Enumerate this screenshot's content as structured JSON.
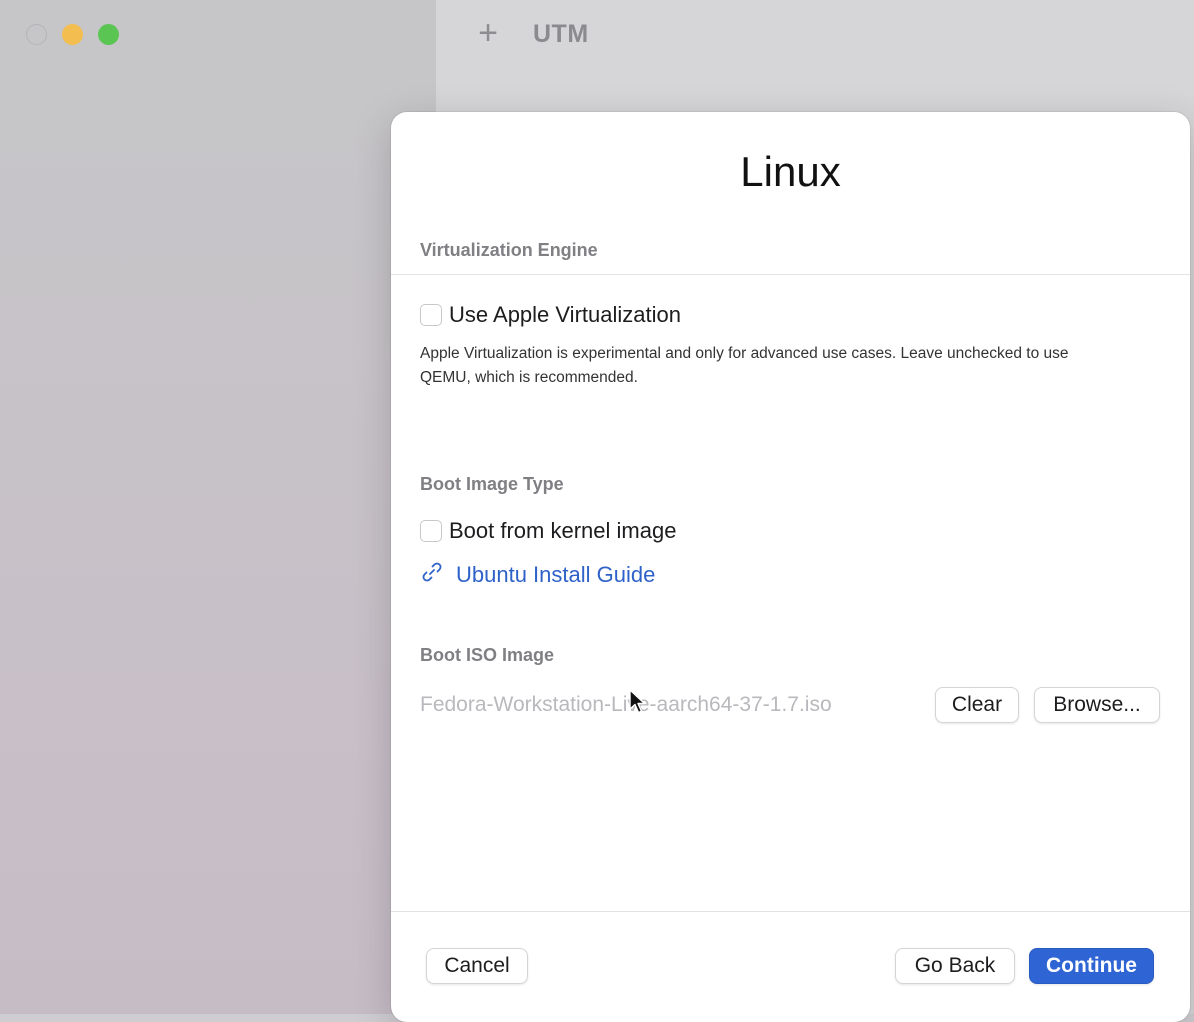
{
  "window": {
    "title": "UTM",
    "add_icon": "plus-icon",
    "traffic_lights": {
      "close": "close-button",
      "minimize": "minimize-button",
      "zoom": "zoom-button"
    }
  },
  "dialog": {
    "title": "Linux",
    "virtualization": {
      "section_label": "Virtualization Engine",
      "checkbox_label": "Use Apple Virtualization",
      "checked": false,
      "note": "Apple Virtualization is experimental and only for advanced use cases. Leave unchecked to use QEMU, which is recommended."
    },
    "boot_image_type": {
      "section_label": "Boot Image Type",
      "checkbox_label": "Boot from kernel image",
      "checked": false,
      "link_label": "Ubuntu Install Guide",
      "link_icon": "link-icon"
    },
    "boot_iso": {
      "section_label": "Boot ISO Image",
      "path": "Fedora-Workstation-Live-aarch64-37-1.7.iso",
      "clear_label": "Clear",
      "browse_label": "Browse..."
    },
    "footer": {
      "cancel_label": "Cancel",
      "go_back_label": "Go Back",
      "continue_label": "Continue"
    }
  },
  "colors": {
    "accent": "#2f64d4",
    "link": "#2f62c8",
    "traffic_minimize": "#f3be4f",
    "traffic_zoom": "#5bc553"
  }
}
